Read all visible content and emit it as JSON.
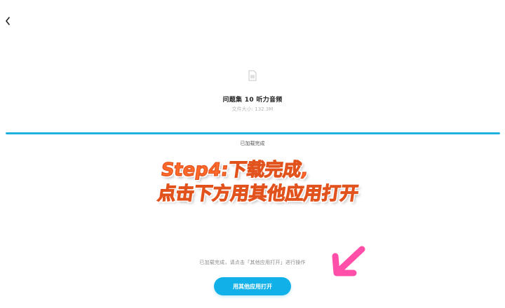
{
  "header": {
    "back_icon": "chevron-left-icon"
  },
  "file": {
    "icon": "file-icon",
    "name": "问题集 10 听力音频",
    "size_text": "文件大小: 132.3M"
  },
  "download": {
    "progress": 1.0,
    "status_text": "已加载完成",
    "hint_text": "已加载完成，请点击「其他应用打开」进行操作"
  },
  "actions": {
    "open_with_other_app_label": "用其他应用打开"
  },
  "annotation": {
    "line1": "Step4:下载完成,",
    "line2": "点击下方用其他应用打开",
    "arrow_icon": "pink-arrow-icon"
  },
  "colors": {
    "accent": "#12b0e8",
    "progress": "#20b0de",
    "caption": "#ff6a2b",
    "arrow": "#ff4fa8"
  }
}
